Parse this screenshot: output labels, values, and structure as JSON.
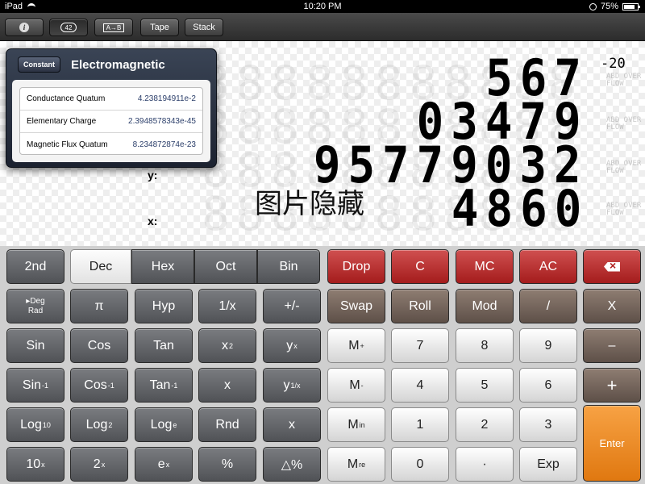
{
  "status_bar": {
    "device": "iPad",
    "time": "10:20 PM",
    "battery": "75%"
  },
  "toolbar": {
    "info_label": "i",
    "constants_label": "42",
    "convert_label": "A→B",
    "tape_label": "Tape",
    "stack_label": "Stack"
  },
  "popover": {
    "tag": "Constant",
    "title": "Electromagnetic",
    "items": [
      {
        "name": "Conductance Quatum",
        "value": "4.238194911e-2"
      },
      {
        "name": "Elementary Charge",
        "value": "2.3948578343e-45"
      },
      {
        "name": "Magnetic Flux Quatum",
        "value": "8.234872874e-23"
      }
    ]
  },
  "display": {
    "reg1": "567",
    "reg1_exponent": "-20",
    "reg2": "03479",
    "reg3": "95779032",
    "reg4": "4860",
    "label_y": "y:",
    "label_x": "x:",
    "overflow_text": "ABD OVER FLOW",
    "watermark": "图片隐藏"
  },
  "keys": {
    "row1": [
      "2nd",
      "Dec",
      "Hex",
      "Oct",
      "Bin",
      "Drop",
      "C",
      "MC",
      "AC"
    ],
    "backspace_icon": "backspace-icon",
    "row2": [
      "Deg",
      "Rad",
      "π",
      "Hyp",
      "1/x",
      "+/-",
      "Swap",
      "Roll",
      "Mod",
      "/",
      "X"
    ],
    "row3": [
      "Sin",
      "Cos",
      "Tan",
      "x",
      "2",
      "y",
      "x",
      "M",
      "+",
      "7",
      "8",
      "9",
      "–"
    ],
    "row4": [
      "Sin",
      "-1",
      "Cos",
      "-1",
      "Tan",
      "-1",
      "x",
      "y",
      "1/x",
      "M",
      "-",
      "4",
      "5",
      "6",
      "+"
    ],
    "row5": [
      "Log",
      "10",
      "Log",
      "2",
      "Log",
      "e",
      "Rnd",
      "x",
      "M",
      "in",
      "1",
      "2",
      "3",
      "Enter"
    ],
    "row6": [
      "10",
      "x",
      "2",
      "x",
      "e",
      "x",
      "%",
      "△%",
      "M",
      "re",
      "0",
      "·",
      "Exp"
    ]
  },
  "colors": {
    "red_key": "#b82828",
    "orange_key": "#ee8a22",
    "brown_key": "#75665c",
    "dark_key": "#626468"
  }
}
